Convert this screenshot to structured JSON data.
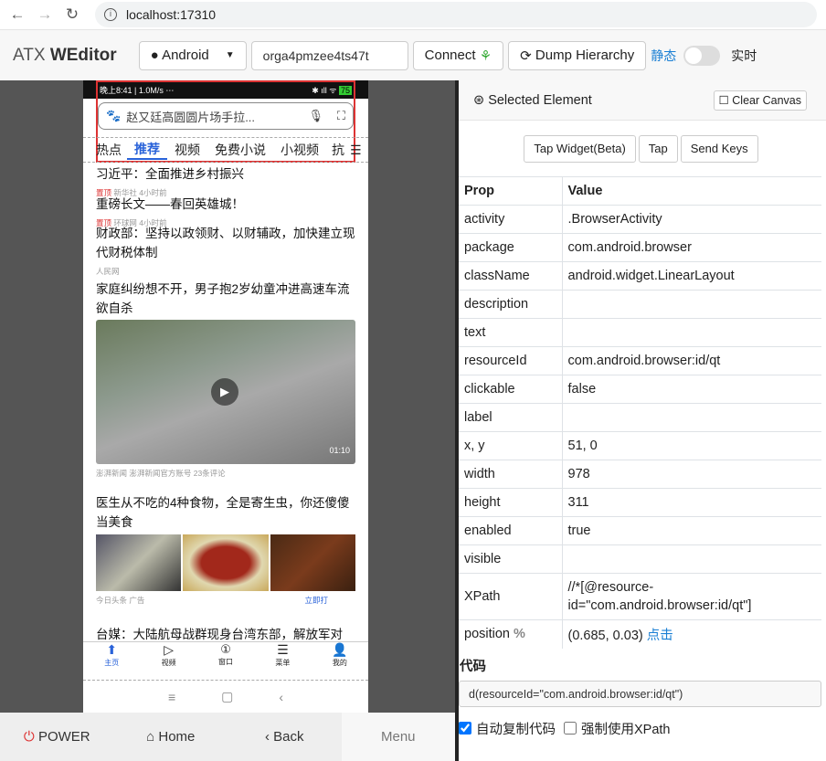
{
  "browser": {
    "url": "localhost:17310"
  },
  "header": {
    "brand_light": "ATX ",
    "brand_bold": "WEditor",
    "platform": "Android",
    "serial": "orga4pmzee4ts47t",
    "connect": "Connect",
    "dump": "Dump Hierarchy",
    "static": "静态",
    "realtime": "实时",
    "realtime_on": false
  },
  "phone": {
    "status": "晚上8:41 | 1.0M/s ⋯",
    "battery": "75",
    "search": "赵又廷高圆圆片场手拉...",
    "tabs": [
      "热点",
      "推荐",
      "视频",
      "免费小说",
      "小视频",
      "抗"
    ],
    "news": [
      {
        "title": "习近平：全面推进乡村振兴",
        "tag": "置顶",
        "meta": "新华社  4小时前"
      },
      {
        "title": "重磅长文——春回英雄城！",
        "tag": "置顶",
        "meta": "环球网  4小时前"
      },
      {
        "title": "财政部：坚持以政领财、以财辅政，加快建立现代财税体制",
        "meta": "人民网"
      },
      {
        "title": "家庭纠纷想不开，男子抱2岁幼童冲进高速车流欲自杀",
        "duration": "01:10",
        "meta": "澎湃新闻 澎湃新闻官方账号 23条评论"
      },
      {
        "title": "医生从不吃的4种食物，全是寄生虫，你还傻傻当美食",
        "meta": "今日头条 广告",
        "action": "立即打"
      },
      {
        "title": "台媒：大陆航母战群现身台湾东部，解放军对"
      }
    ],
    "nav": [
      "主页",
      "视频",
      "窗口",
      "菜单",
      "我的"
    ],
    "sysnav": [
      "≡",
      "▢",
      "‹"
    ]
  },
  "controls": {
    "power": "POWER",
    "home": "Home",
    "back": "Back",
    "menu": "Menu"
  },
  "panel": {
    "title": "Selected Element",
    "clear": "Clear Canvas",
    "tap_widget": "Tap Widget(Beta)",
    "tap": "Tap",
    "send_keys": "Send Keys",
    "col_prop": "Prop",
    "col_value": "Value",
    "rows": [
      {
        "prop": "activity",
        "value": ".BrowserActivity"
      },
      {
        "prop": "package",
        "value": "com.android.browser"
      },
      {
        "prop": "className",
        "value": "android.widget.LinearLayout"
      },
      {
        "prop": "description",
        "value": ""
      },
      {
        "prop": "text",
        "value": ""
      },
      {
        "prop": "resourceId",
        "value": "com.android.browser:id/qt"
      },
      {
        "prop": "clickable",
        "value": "false"
      },
      {
        "prop": "label",
        "value": ""
      },
      {
        "prop": "x, y",
        "value": "51, 0"
      },
      {
        "prop": "width",
        "value": "978"
      },
      {
        "prop": "height",
        "value": "311"
      },
      {
        "prop": "enabled",
        "value": "true"
      },
      {
        "prop": "visible",
        "value": ""
      },
      {
        "prop": "XPath",
        "value": "//*[@resource-id=\"com.android.browser:id/qt\"]"
      }
    ],
    "position_label": "position",
    "position_unit": "%",
    "position_value": "(0.685, 0.03)",
    "position_click": "点击",
    "code_label": "代码",
    "code": "d(resourceId=\"com.android.browser:id/qt\")",
    "auto_copy": "自动复制代码",
    "auto_copy_checked": true,
    "force_xpath": "强制使用XPath",
    "force_xpath_checked": false
  }
}
